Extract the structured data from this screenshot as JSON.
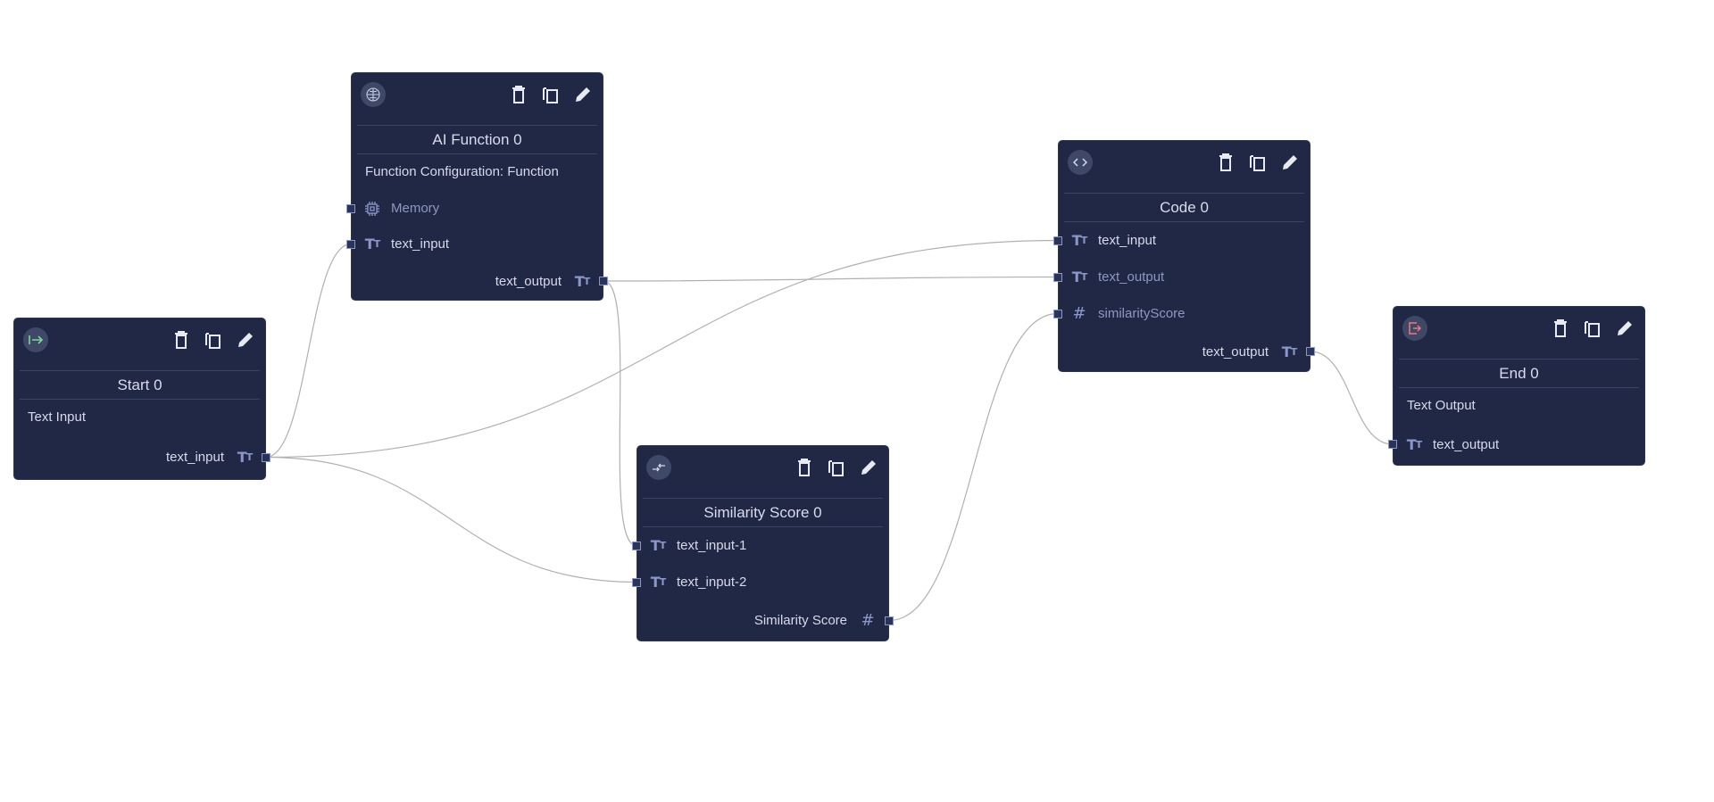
{
  "canvas": {
    "background": "#ffffff",
    "node_color": "#212845",
    "edge_color": "#b0b0b0",
    "port_color": "#8c97c9"
  },
  "actions": {
    "delete": "trash-icon",
    "duplicate": "copy-icon",
    "edit": "pencil-icon"
  },
  "nodes": {
    "ai_function": {
      "icon": "brain-icon",
      "title": "AI Function 0",
      "description": "Function Configuration: Function",
      "inputs": [
        {
          "label": "Memory",
          "type": "memory",
          "icon": "chip-icon"
        },
        {
          "label": "text_input",
          "type": "text",
          "icon": "text-type-icon"
        }
      ],
      "outputs": [
        {
          "label": "text_output",
          "type": "text",
          "icon": "text-type-icon"
        }
      ]
    },
    "start": {
      "icon": "start-arrow-icon",
      "icon_color": "#7fd49a",
      "title": "Start 0",
      "description": "Text Input",
      "outputs": [
        {
          "label": "text_input",
          "type": "text",
          "icon": "text-type-icon"
        }
      ]
    },
    "similarity": {
      "icon": "compare-arrows-icon",
      "title": "Similarity Score 0",
      "inputs": [
        {
          "label": "text_input-1",
          "type": "text",
          "icon": "text-type-icon"
        },
        {
          "label": "text_input-2",
          "type": "text",
          "icon": "text-type-icon"
        }
      ],
      "outputs": [
        {
          "label": "Similarity Score",
          "type": "number",
          "icon": "hash-icon"
        }
      ]
    },
    "code": {
      "icon": "code-icon",
      "title": "Code 0",
      "inputs": [
        {
          "label": "text_input",
          "type": "text",
          "icon": "text-type-icon"
        },
        {
          "label": "text_output",
          "type": "text",
          "icon": "text-type-icon"
        },
        {
          "label": "similarityScore",
          "type": "number",
          "icon": "hash-icon"
        }
      ],
      "outputs": [
        {
          "label": "text_output",
          "type": "text",
          "icon": "text-type-icon"
        }
      ]
    },
    "end": {
      "icon": "exit-icon",
      "icon_color": "#e8797a",
      "title": "End 0",
      "description": "Text Output",
      "inputs": [
        {
          "label": "text_output",
          "type": "text",
          "icon": "text-type-icon"
        }
      ]
    }
  },
  "edges": [
    {
      "from": "start.text_input",
      "to": "ai_function.text_input"
    },
    {
      "from": "start.text_input",
      "to": "code.text_input"
    },
    {
      "from": "start.text_input",
      "to": "similarity.text_input-2"
    },
    {
      "from": "ai_function.text_output",
      "to": "code.text_output"
    },
    {
      "from": "ai_function.text_output",
      "to": "similarity.text_input-1"
    },
    {
      "from": "similarity.Similarity Score",
      "to": "code.similarityScore"
    },
    {
      "from": "code.text_output",
      "to": "end.text_output"
    }
  ]
}
